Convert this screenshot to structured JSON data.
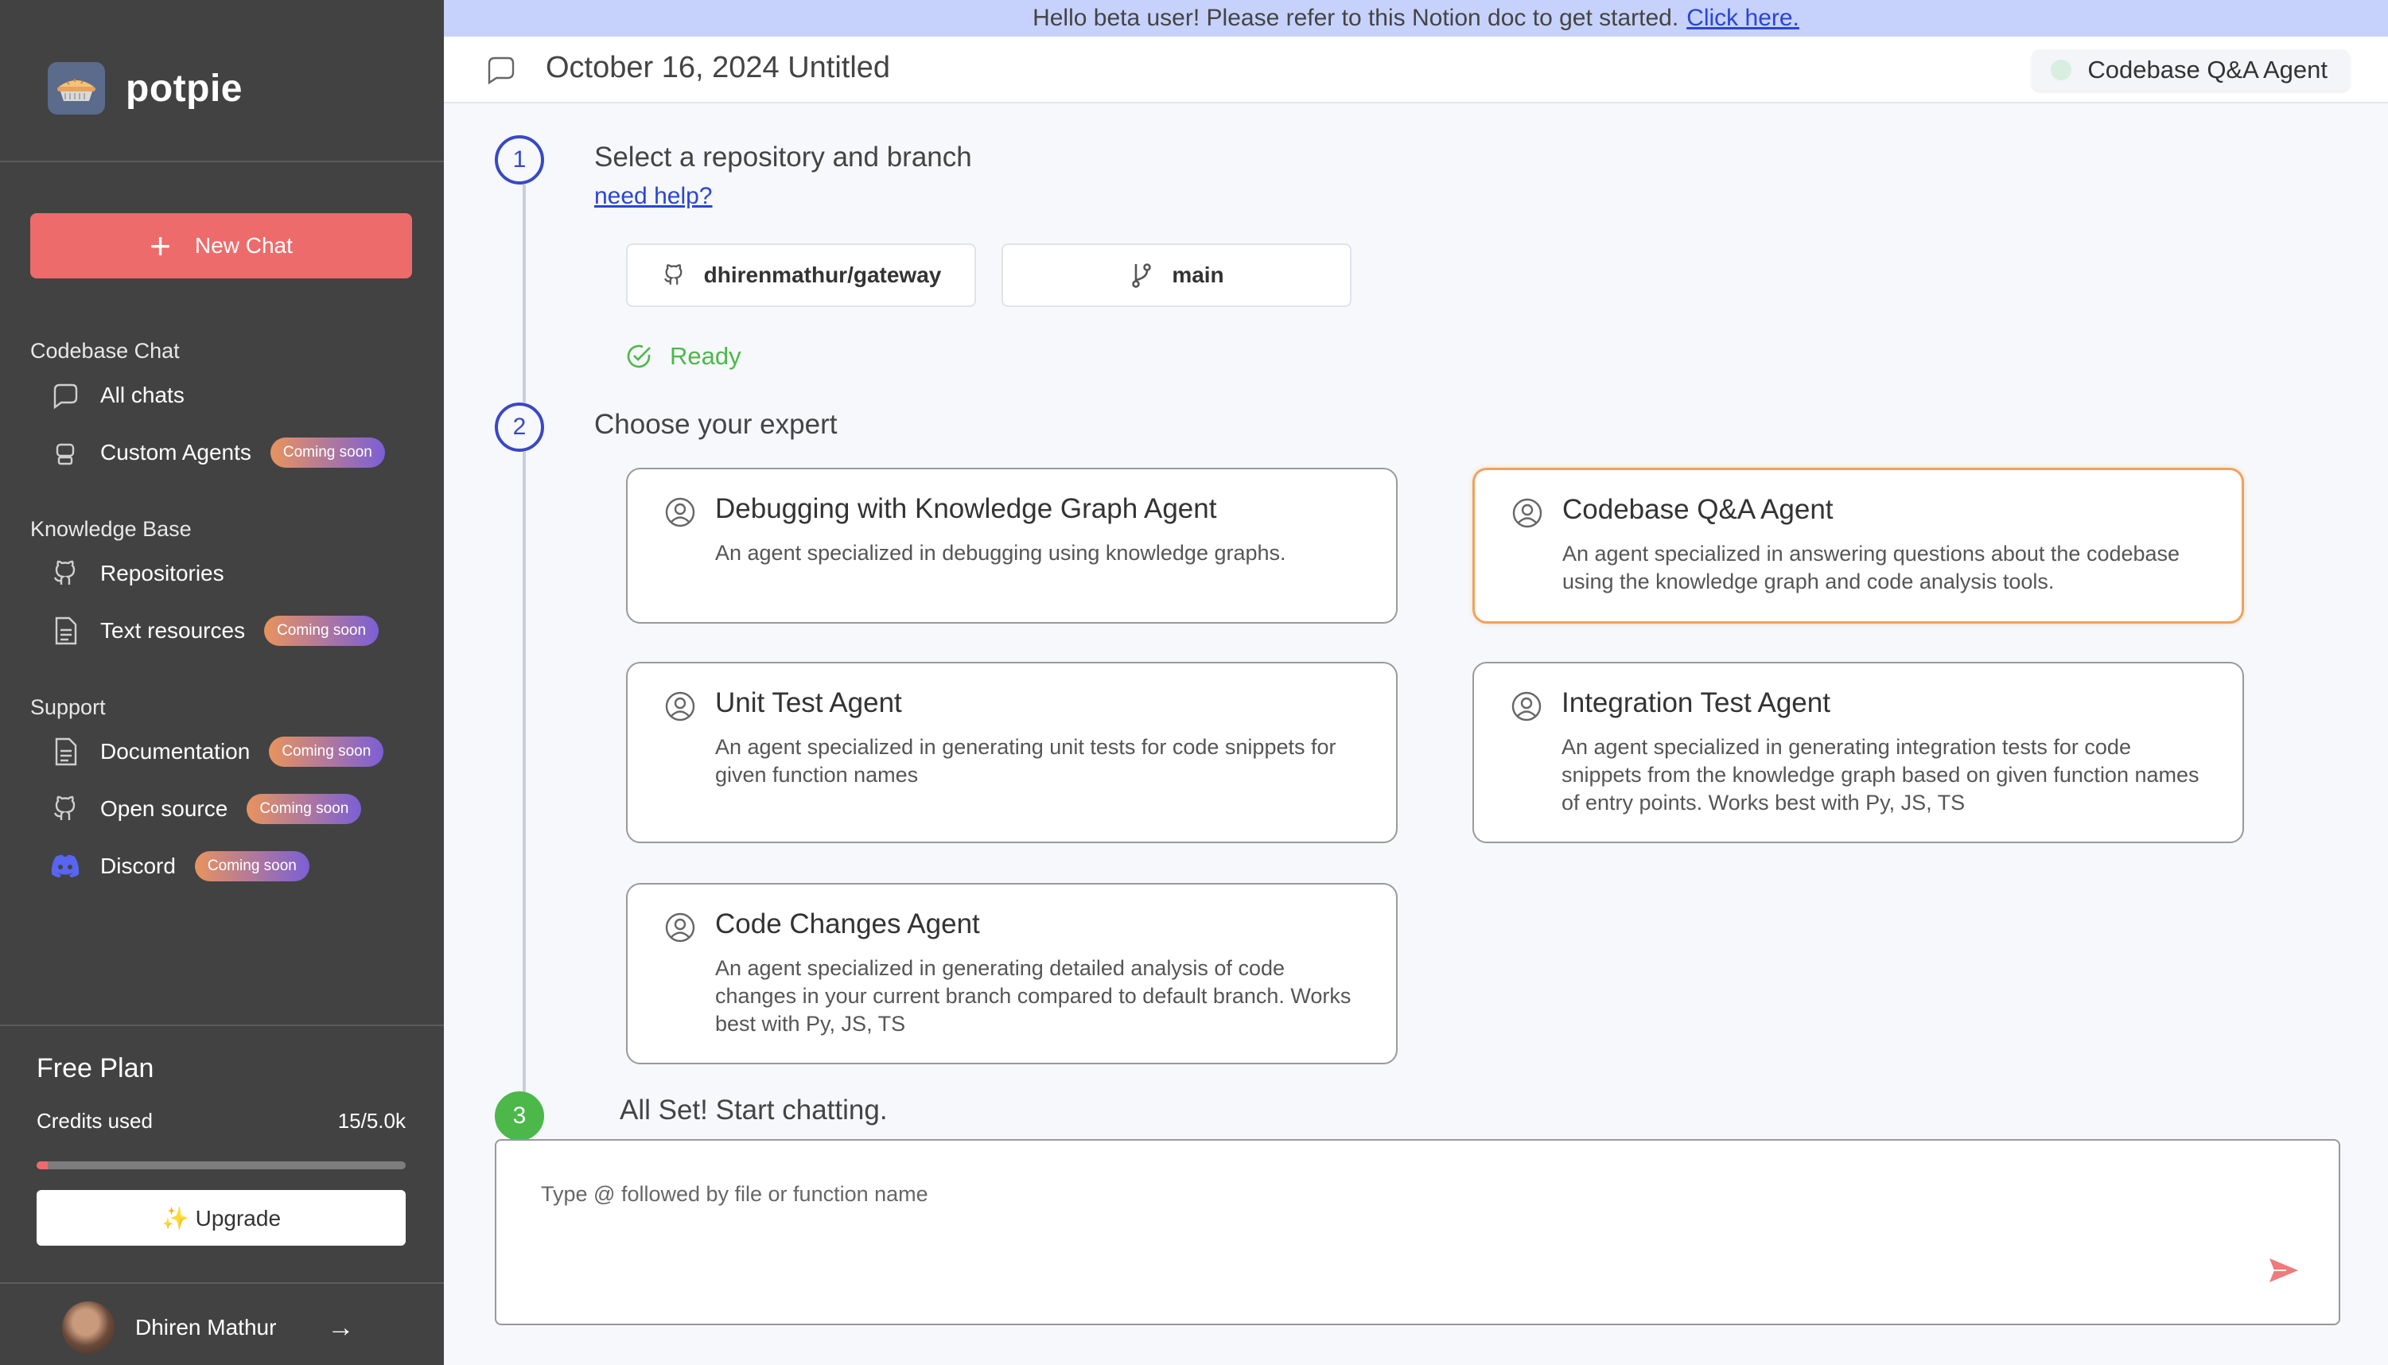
{
  "sidebar": {
    "brand": "potpie",
    "new_chat_label": "New Chat",
    "sections": [
      {
        "label": "Codebase Chat",
        "items": [
          {
            "label": "All chats",
            "icon": "chat-icon",
            "badge": ""
          },
          {
            "label": "Custom Agents",
            "icon": "robot-icon",
            "badge": "Coming soon"
          }
        ]
      },
      {
        "label": "Knowledge Base",
        "items": [
          {
            "label": "Repositories",
            "icon": "github-icon",
            "badge": ""
          },
          {
            "label": "Text resources",
            "icon": "document-icon",
            "badge": "Coming soon"
          }
        ]
      },
      {
        "label": "Support",
        "items": [
          {
            "label": "Documentation",
            "icon": "document-icon",
            "badge": "Coming soon"
          },
          {
            "label": "Open source",
            "icon": "github-icon",
            "badge": "Coming soon"
          },
          {
            "label": "Discord",
            "icon": "discord-icon",
            "badge": "Coming soon"
          }
        ]
      }
    ],
    "plan": {
      "title": "Free Plan",
      "credits_label": "Credits used",
      "credits_value": "15/5.0k",
      "credits_fraction": 0.03,
      "upgrade_label": "✨ Upgrade"
    },
    "user": {
      "name": "Dhiren Mathur",
      "logout_symbol": "→"
    }
  },
  "banner": {
    "text": "Hello beta user! Please refer to this Notion doc to get started.",
    "link_text": "Click here."
  },
  "header": {
    "title": "October 16, 2024 Untitled",
    "agent_pill": "Codebase Q&A Agent"
  },
  "steps": {
    "step1": {
      "number": "1",
      "title": "Select a repository and branch",
      "help_link": "need help?"
    },
    "repo": "dhirenmathur/gateway",
    "branch": "main",
    "status": "Ready",
    "step2": {
      "number": "2",
      "title": "Choose your expert"
    },
    "agents": [
      {
        "title": "Debugging with Knowledge Graph Agent",
        "desc": "An agent specialized in debugging using knowledge graphs.",
        "selected": false
      },
      {
        "title": "Codebase Q&A Agent",
        "desc": "An agent specialized in answering questions about the codebase using the knowledge graph and code analysis tools.",
        "selected": true
      },
      {
        "title": "Unit Test Agent",
        "desc": "An agent specialized in generating unit tests for code snippets for given function names",
        "selected": false
      },
      {
        "title": "Integration Test Agent",
        "desc": "An agent specialized in generating integration tests for code snippets from the knowledge graph based on given function names of entry points. Works best with Py, JS, TS",
        "selected": false
      },
      {
        "title": "Code Changes Agent",
        "desc": "An agent specialized in generating detailed analysis of code changes in your current branch compared to default branch. Works best with Py, JS, TS",
        "selected": false
      }
    ],
    "step3": {
      "number": "3",
      "title": "All Set! Start chatting."
    }
  },
  "chat_input": {
    "placeholder": "Type @ followed by file or function name",
    "value": ""
  },
  "colors": {
    "accent": "#ee6b6b",
    "step": "#3948c6",
    "ready": "#4cb84a",
    "selected_border": "#f0a25c"
  }
}
